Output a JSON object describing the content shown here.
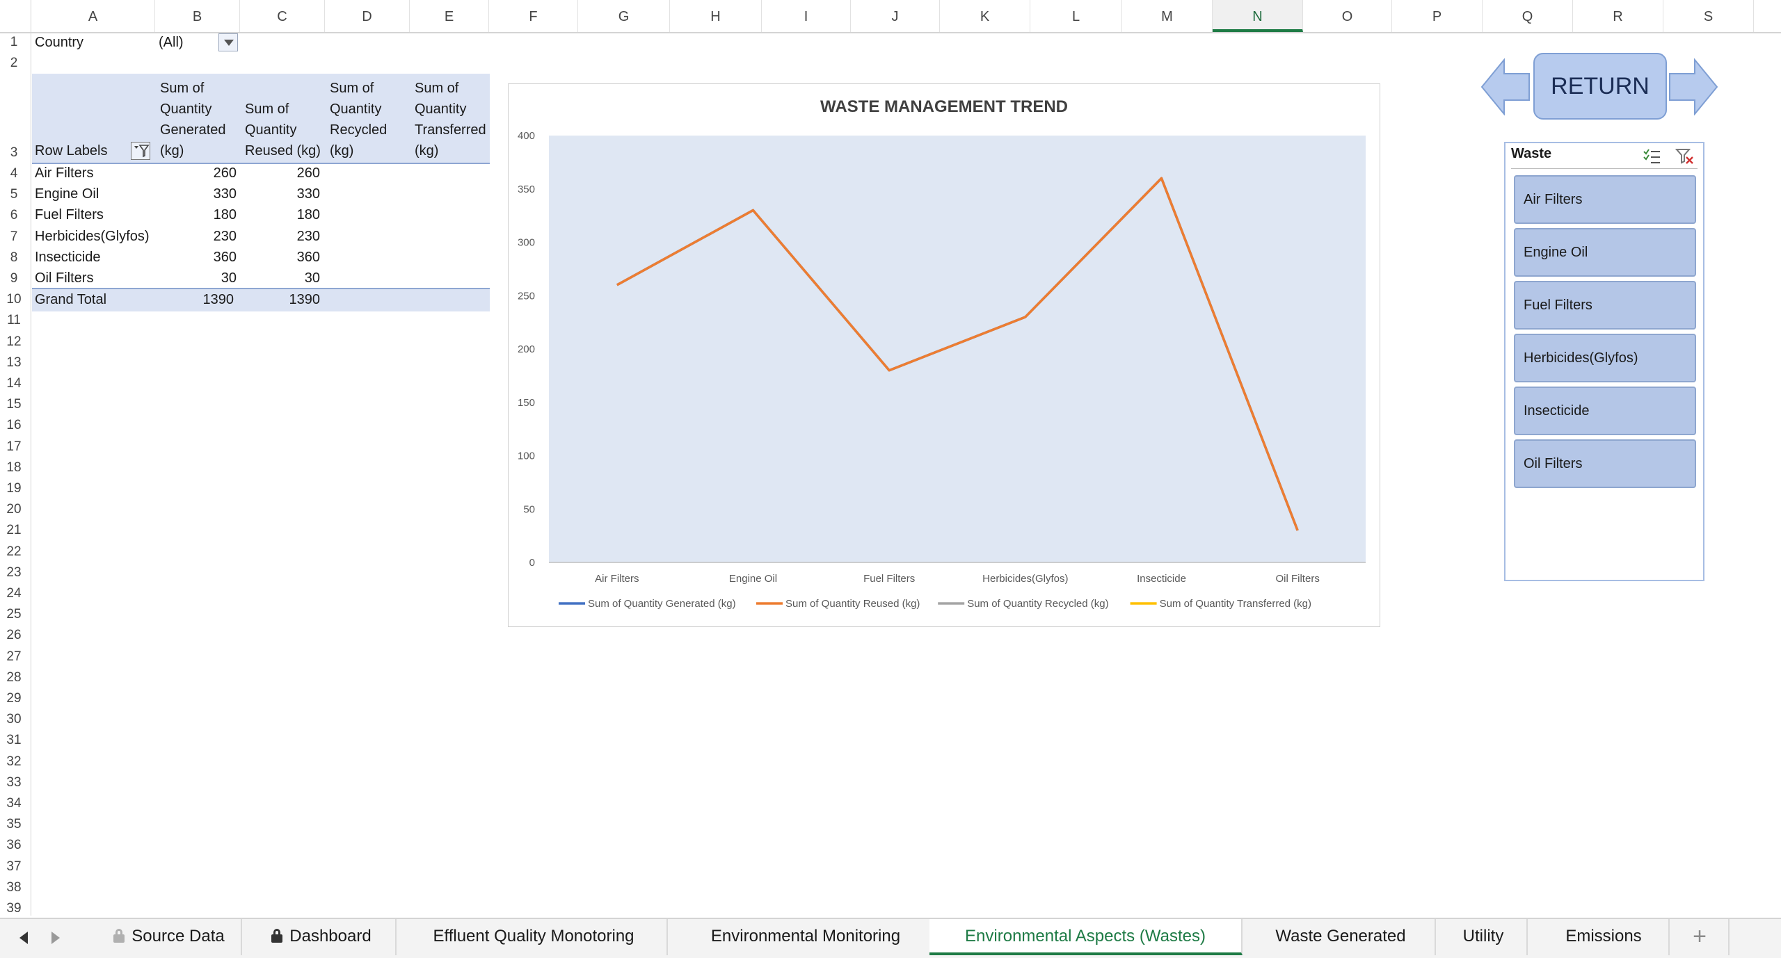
{
  "columns": [
    "A",
    "B",
    "C",
    "D",
    "E",
    "F",
    "G",
    "H",
    "I",
    "J",
    "K",
    "L",
    "M",
    "N",
    "O",
    "P",
    "Q",
    "R",
    "S"
  ],
  "selected_column": "N",
  "rows": [
    "1",
    "2",
    "3",
    "4",
    "5",
    "6",
    "7",
    "8",
    "9",
    "10",
    "11",
    "12",
    "13",
    "14",
    "15",
    "16",
    "17",
    "18",
    "19",
    "20",
    "21",
    "22",
    "23",
    "24",
    "25",
    "26",
    "27",
    "28",
    "29",
    "30",
    "31",
    "32",
    "33",
    "34",
    "35",
    "36",
    "37",
    "38",
    "39"
  ],
  "filter": {
    "label": "Country",
    "value": "(All)"
  },
  "pivot": {
    "row_labels_header": "Row Labels",
    "headers": [
      [
        "Sum of",
        "Quantity",
        "Generated",
        "(kg)"
      ],
      [
        "Sum of",
        "Quantity",
        "Reused (kg)"
      ],
      [
        "Sum of",
        "Quantity",
        "Recycled",
        "(kg)"
      ],
      [
        "Sum of",
        "Quantity",
        "Transferred",
        "(kg)"
      ]
    ],
    "rows": [
      {
        "label": "Air Filters",
        "generated": "260",
        "reused": "260"
      },
      {
        "label": "Engine Oil",
        "generated": "330",
        "reused": "330"
      },
      {
        "label": "Fuel Filters",
        "generated": "180",
        "reused": "180"
      },
      {
        "label": "Herbicides(Glyfos)",
        "generated": "230",
        "reused": "230"
      },
      {
        "label": "Insecticide",
        "generated": "360",
        "reused": "360"
      },
      {
        "label": "Oil Filters",
        "generated": "30",
        "reused": "30"
      }
    ],
    "grand_total": {
      "label": "Grand Total",
      "generated": "1390",
      "reused": "1390"
    }
  },
  "chart_data": {
    "type": "line",
    "title": "WASTE MANAGEMENT TREND",
    "categories": [
      "Air Filters",
      "Engine Oil",
      "Fuel Filters",
      "Herbicides(Glyfos)",
      "Insecticide",
      "Oil Filters"
    ],
    "yticks": [
      "0",
      "50",
      "100",
      "150",
      "200",
      "250",
      "300",
      "350",
      "400"
    ],
    "ylim": [
      0,
      400
    ],
    "series": [
      {
        "name": "Sum of Quantity Generated (kg)",
        "color": "#4472c4",
        "values": [
          260,
          330,
          180,
          230,
          360,
          30
        ]
      },
      {
        "name": "Sum of Quantity Reused (kg)",
        "color": "#ed7d31",
        "values": [
          260,
          330,
          180,
          230,
          360,
          30
        ]
      },
      {
        "name": "Sum of Quantity Recycled (kg)",
        "color": "#a5a5a5",
        "values": []
      },
      {
        "name": "Sum of Quantity Transferred (kg)",
        "color": "#ffc000",
        "values": []
      }
    ],
    "plot_background": "#dfe7f3",
    "legend_position": "bottom",
    "grid": false
  },
  "return_button": "RETURN",
  "slicer": {
    "title": "Waste",
    "items": [
      "Air Filters",
      "Engine Oil",
      "Fuel Filters",
      "Herbicides(Glyfos)",
      "Insecticide",
      "Oil Filters"
    ]
  },
  "sheet_tabs": [
    {
      "label": "Source Data",
      "locked": true
    },
    {
      "label": "Dashboard",
      "locked": true
    },
    {
      "label": "Effluent Quality Monotoring",
      "locked": false
    },
    {
      "label": "Environmental Monitoring",
      "locked": false
    },
    {
      "label": "Environmental Aspects (Wastes)",
      "locked": false,
      "active": true
    },
    {
      "label": "Waste Generated",
      "locked": false
    },
    {
      "label": "Utility",
      "locked": false
    },
    {
      "label": "Emissions",
      "locked": false
    }
  ],
  "add_sheet": "+",
  "icons": {
    "nav_prev": "triangle-left-icon",
    "nav_next": "triangle-right-icon",
    "multiselect": "multiselect-icon",
    "clear_filter": "clear-filter-icon"
  }
}
